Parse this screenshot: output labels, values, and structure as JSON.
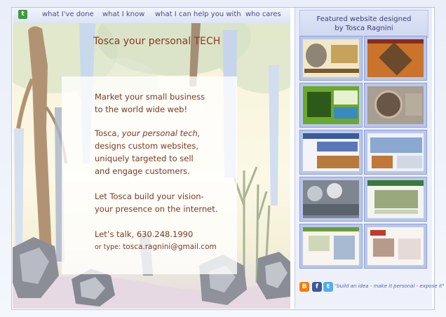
{
  "nav": {
    "logo_glyph": "t",
    "links": [
      "what I've done",
      "what I know",
      "what I can help you with",
      "who cares"
    ]
  },
  "main": {
    "title_bold": "Tosca",
    "title_rest": " your personal TECH",
    "line1": "Market your small business",
    "line2": " to the world wide web!",
    "p2_a": "Tosca, ",
    "p2_b": "your personal tech,",
    "p2_c": "designs custom websites,",
    "p2_d": "uniquely targeted to sell",
    "p2_e": "and engage customers.",
    "p3_a": "Let Tosca build your vision-",
    "p3_b": "your presence on the internet.",
    "contact": "Let’s talk, 630.248.1990",
    "email_prefix": "or type: ",
    "email": "tosca.ragnini@gmail.com"
  },
  "sidebar": {
    "header_line1": "Featured website designed",
    "header_line2": "by Tosca Ragnini",
    "tagline": "\"build an idea - make it personal - expose it\""
  },
  "colors": {
    "accent": "#3e9b3a",
    "nav_text": "#4a4a88",
    "body_text": "#7a3a22",
    "thumb_border": "#8ea0d4",
    "blogger": "#f57d00",
    "facebook": "#3b5998",
    "twitter": "#55acee"
  },
  "icons": [
    "logo-icon",
    "blogger-icon",
    "facebook-icon",
    "twitter-icon"
  ]
}
